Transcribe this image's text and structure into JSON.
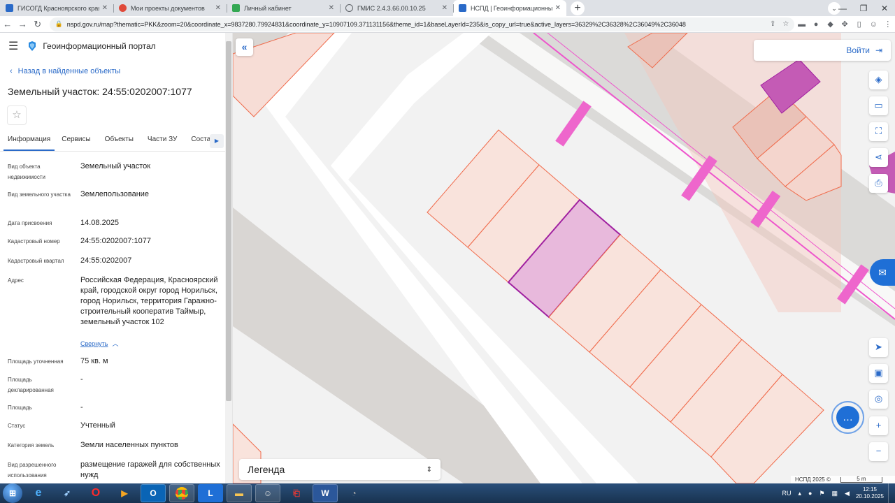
{
  "browser": {
    "tabs": [
      {
        "title": "ГИСОГД Красноярского края",
        "color": "#2a6ac8"
      },
      {
        "title": "Мои проекты документов",
        "color": "#e04a3a"
      },
      {
        "title": "Личный кабинет",
        "color": "#34a853"
      },
      {
        "title": "ГМИС 2.4.3.66.00.10.25",
        "color": "#5f6368"
      },
      {
        "title": "НСПД | Геоинформационный п",
        "color": "#2a6ac8"
      }
    ],
    "url": "nspd.gov.ru/map?thematic=PKK&zoom=20&coordinate_x=9837280.79924831&coordinate_y=10907109.371131156&theme_id=1&baseLayerId=235&is_copy_url=true&active_layers=36329%2C36328%2C36049%2C36048"
  },
  "sidebar": {
    "portal_name": "Геоинформационный портал",
    "back_label": "Назад в найденные объекты",
    "object_title": "Земельный участок: 24:55:0202007:1077",
    "tabs": [
      "Информация",
      "Сервисы",
      "Объекты",
      "Части ЗУ",
      "Соста"
    ],
    "properties": [
      {
        "label": "Вид объекта недвижимости",
        "value": "Земельный участок"
      },
      {
        "label": "Вид земельного участка",
        "value": "Землепользование"
      },
      {
        "label": "Дата присвоения",
        "value": "14.08.2025"
      },
      {
        "label": "Кадастровый номер",
        "value": "24:55:0202007:1077"
      },
      {
        "label": "Кадастровый квартал",
        "value": "24:55:0202007"
      },
      {
        "label": "Адрес",
        "value": "Российская Федерация, Красноярский край, городской округ город Норильск, город Норильск, территория Гаражно-строительный кооператив Таймыр, земельный участок 102"
      },
      {
        "label": "Площадь уточненная",
        "value": "75 кв. м"
      },
      {
        "label": "Площадь декларированная",
        "value": "-"
      },
      {
        "label": "Площадь",
        "value": "-"
      },
      {
        "label": "Статус",
        "value": "Учтенный"
      },
      {
        "label": "Категория земель",
        "value": "Земли населенных пунктов"
      },
      {
        "label": "Вид разрешенного использования",
        "value": "размещение гаражей для собственных нужд"
      }
    ],
    "collapse_label": "Свернуть"
  },
  "map": {
    "login_label": "Войти",
    "legend_label": "Легенда",
    "copyright": "НСПД 2025 ©",
    "scale_label": "5 m",
    "colors": {
      "parcel_stroke": "#f06a4a",
      "parcel_fill": "#fbe6e0",
      "selected_fill": "#e6b6dc",
      "selected_stroke": "#a020a0",
      "zone": "#ee55cc",
      "accent": "#2a6ac8"
    }
  },
  "taskbar": {
    "lang": "RU",
    "time": "12:15",
    "date": "20.10.2025"
  }
}
